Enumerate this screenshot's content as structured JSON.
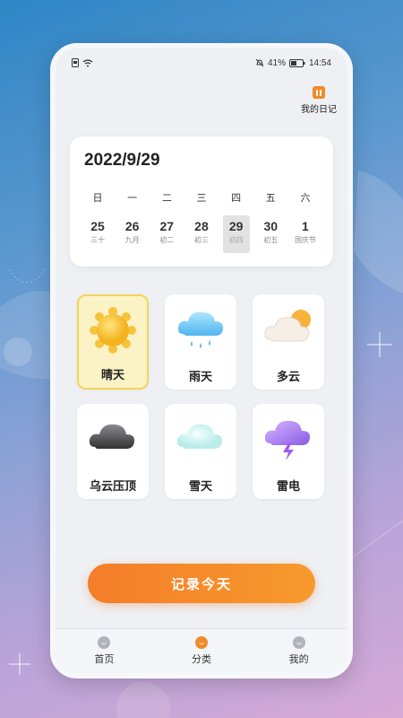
{
  "status_bar": {
    "battery": "41%",
    "time": "14:54"
  },
  "header": {
    "diary_label": "我的日记",
    "diary_icon": "pause-icon"
  },
  "calendar": {
    "date": "2022/9/29",
    "weekdays": [
      "日",
      "一",
      "二",
      "三",
      "四",
      "五",
      "六"
    ],
    "days": [
      {
        "num": "25",
        "lunar": "三十"
      },
      {
        "num": "26",
        "lunar": "九月"
      },
      {
        "num": "27",
        "lunar": "初二"
      },
      {
        "num": "28",
        "lunar": "初三"
      },
      {
        "num": "29",
        "lunar": "初四"
      },
      {
        "num": "30",
        "lunar": "初五"
      },
      {
        "num": "1",
        "lunar": "国庆节"
      }
    ],
    "selected_index": 4
  },
  "weather": {
    "items": [
      {
        "label": "晴天",
        "icon": "sun-icon"
      },
      {
        "label": "雨天",
        "icon": "rain-cloud-icon"
      },
      {
        "label": "多云",
        "icon": "cloudy-icon"
      },
      {
        "label": "乌云压顶",
        "icon": "dark-cloud-icon"
      },
      {
        "label": "雪天",
        "icon": "snow-cloud-icon"
      },
      {
        "label": "雷电",
        "icon": "thunder-cloud-icon"
      }
    ],
    "selected_index": 0
  },
  "record_button": "记录今天",
  "tabs": [
    {
      "label": "首页",
      "icon": "home-icon"
    },
    {
      "label": "分类",
      "icon": "category-icon"
    },
    {
      "label": "我的",
      "icon": "profile-icon"
    }
  ],
  "active_tab": 1,
  "colors": {
    "accent": "#f28b2b",
    "selected_tile": "#fbf3c6"
  }
}
